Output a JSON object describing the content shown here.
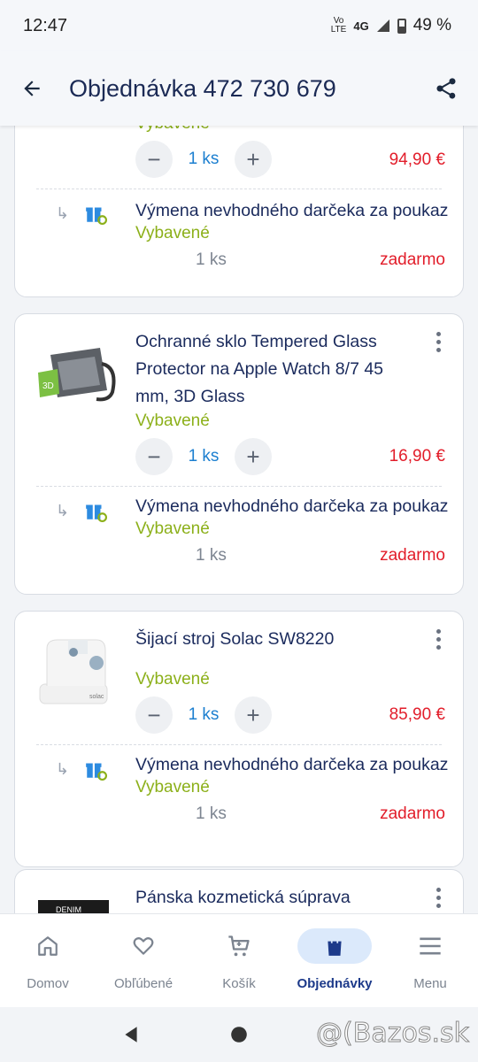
{
  "status_bar": {
    "time": "12:47",
    "network_top": "Vo",
    "network_bottom": "LTE",
    "network_type": "4G",
    "battery": "49 %"
  },
  "app_bar": {
    "title": "Objednávka 472 730 679"
  },
  "orders": [
    {
      "name": "",
      "status": "Vybavené",
      "quantity": "1 ks",
      "price": "94,90 €",
      "gift": {
        "name": "Výmena nevhodného darčeka za poukaz",
        "status": "Vybavené",
        "quantity": "1 ks",
        "price": "zadarmo"
      }
    },
    {
      "name": "Ochranné sklo Tempered Glass Protector na Apple Watch 8/7 45 mm, 3D Glass",
      "name_lines": [
        "Ochranné sklo Tempered Glass",
        "Protector na Apple Watch 8/7 45",
        "mm, 3D Glass"
      ],
      "status": "Vybavené",
      "quantity": "1 ks",
      "price": "16,90 €",
      "gift": {
        "name": "Výmena nevhodného darčeka za poukaz",
        "status": "Vybavené",
        "quantity": "1 ks",
        "price": "zadarmo"
      }
    },
    {
      "name": "Šijací stroj Solac SW8220",
      "status": "Vybavené",
      "quantity": "1 ks",
      "price": "85,90 €",
      "gift": {
        "name": "Výmena nevhodného darčeka za poukaz",
        "status": "Vybavené",
        "quantity": "1 ks",
        "price": "zadarmo"
      }
    },
    {
      "name": "Pánska kozmetická súprava",
      "thumb_text": "DENIM"
    }
  ],
  "thumb_labels": {
    "glass": "3D",
    "machine": "solac"
  },
  "bottom_nav": [
    {
      "label": "Domov",
      "icon": "home-icon"
    },
    {
      "label": "Obľúbené",
      "icon": "heart-icon"
    },
    {
      "label": "Košík",
      "icon": "cart-icon"
    },
    {
      "label": "Objednávky",
      "icon": "shopping-bag-icon",
      "active": true
    },
    {
      "label": "Menu",
      "icon": "menu-icon"
    }
  ],
  "watermark": "@(Bazos.sk",
  "colors": {
    "accent": "#1c7fd0",
    "price": "#e21d2a",
    "status": "#8cb01a",
    "text": "#1a2a5c"
  }
}
